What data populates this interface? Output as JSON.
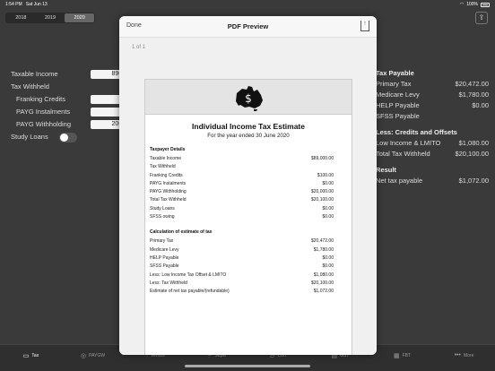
{
  "status": {
    "time": "1:54 PM",
    "date": "Sat Jun 13",
    "battery": "100%"
  },
  "years": [
    "2018",
    "2019",
    "2020"
  ],
  "form": {
    "taxable_income_label": "Taxable Income",
    "taxable_income_value": "89000",
    "tax_withheld_label": "Tax Withheld",
    "franking_label": "Franking Credits",
    "franking_value": "100",
    "payg_inst_label": "PAYG Instalments",
    "payg_inst_value": "0",
    "payg_with_label": "PAYG Withholding",
    "payg_with_value": "20000",
    "study_loans_label": "Study Loans"
  },
  "results": {
    "tax_payable_head": "Tax Payable",
    "primary_tax_label": "Primary Tax",
    "primary_tax_value": "$20,472.00",
    "medicare_label": "Medicare Levy",
    "medicare_value": "$1,780.00",
    "help_label": "HELP Payable",
    "help_value": "$0.00",
    "sfss_label": "SFSS Payable",
    "credits_head": "Less: Credits and Offsets",
    "lmito_label": "Low Income & LMITO",
    "lmito_value": "$1,080.00",
    "withheld_label": "Total Tax Withheld",
    "withheld_value": "$20,100.00",
    "result_head": "Result",
    "net_label": "Net tax payable",
    "net_value": "$1,072.00"
  },
  "tabs": [
    {
      "label": "Tax",
      "icon": "tax-icon"
    },
    {
      "label": "PAYGW",
      "icon": "paygw-icon"
    },
    {
      "label": "Vehicle",
      "icon": "vehicle-icon"
    },
    {
      "label": "Super",
      "icon": "super-icon"
    },
    {
      "label": "CGT",
      "icon": "cgt-icon"
    },
    {
      "label": "GST",
      "icon": "gst-icon"
    },
    {
      "label": "FBT",
      "icon": "fbt-icon"
    },
    {
      "label": "More",
      "icon": "more-icon"
    }
  ],
  "modal": {
    "done_label": "Done",
    "title": "PDF Preview",
    "page_count": "1 of 1"
  },
  "doc": {
    "title": "Individual Income Tax Estimate",
    "subtitle": "For the year ended 30 June 2020",
    "section1": "Taxpayer Details",
    "details": [
      {
        "label": "Taxable Income",
        "value": "$89,000.00"
      },
      {
        "label": "Tax Withheld",
        "value": ""
      },
      {
        "label": "Franking Credits",
        "value": "$100.00"
      },
      {
        "label": "PAYG Instalments",
        "value": "$0.00"
      },
      {
        "label": "PAYG Withholding",
        "value": "$20,000.00"
      },
      {
        "label": "Total Tax Withheld",
        "value": "$20,100.00"
      },
      {
        "label": "Study Loans",
        "value": "$0.00"
      },
      {
        "label": "SFSS owing",
        "value": "$0.00"
      }
    ],
    "section2": "Calculation of estimate of tax",
    "calc": [
      {
        "label": "Primary Tax",
        "value": "$20,472.00"
      },
      {
        "label": "Medicare Levy",
        "value": "$1,780.00"
      },
      {
        "label": "HELP Payable",
        "value": "$0.00"
      },
      {
        "label": "SFSS Payable",
        "value": "$0.00"
      },
      {
        "label": "Less: Low Income Tax Offset & LMITO",
        "value": "$1,080.00"
      },
      {
        "label": "Less: Tax Withheld",
        "value": "$20,100.00"
      },
      {
        "label": "Estimate of net tax payable/(refundable)",
        "value": "$1,072.00"
      }
    ]
  }
}
